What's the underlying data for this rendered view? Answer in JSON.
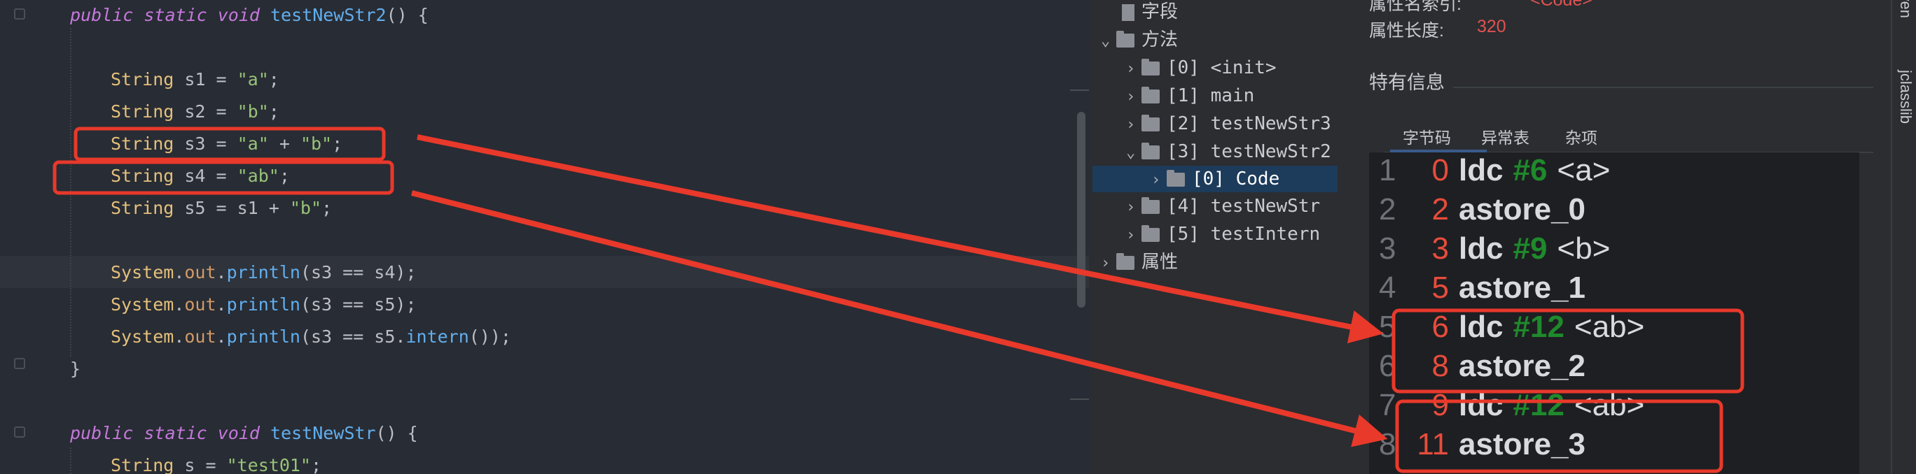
{
  "editor": {
    "lines": [
      {
        "parts": [
          [
            "kw",
            "public static void "
          ],
          [
            "fn",
            "testNewStr2"
          ],
          [
            "pl",
            "() {"
          ]
        ]
      },
      {
        "parts": []
      },
      {
        "parts": [
          [
            "ty",
            "String "
          ],
          [
            "pl",
            "s1 = "
          ],
          [
            "st",
            "\"a\""
          ],
          [
            "pl",
            ";"
          ]
        ]
      },
      {
        "parts": [
          [
            "ty",
            "String "
          ],
          [
            "pl",
            "s2 = "
          ],
          [
            "st",
            "\"b\""
          ],
          [
            "pl",
            ";"
          ]
        ]
      },
      {
        "parts": [
          [
            "ty",
            "String "
          ],
          [
            "pl",
            "s3 = "
          ],
          [
            "st",
            "\"a\""
          ],
          [
            "pl",
            " + "
          ],
          [
            "st",
            "\"b\""
          ],
          [
            "pl",
            ";"
          ]
        ]
      },
      {
        "parts": [
          [
            "ty",
            "String "
          ],
          [
            "pl",
            "s4 = "
          ],
          [
            "st",
            "\"ab\""
          ],
          [
            "pl",
            ";"
          ]
        ]
      },
      {
        "parts": [
          [
            "ty",
            "String "
          ],
          [
            "pl",
            "s5 = s1 + "
          ],
          [
            "st",
            "\"b\""
          ],
          [
            "pl",
            ";"
          ]
        ]
      },
      {
        "parts": []
      },
      {
        "parts": [
          [
            "ty",
            "System"
          ],
          [
            "pl",
            "."
          ],
          [
            "fd",
            "out"
          ],
          [
            "pl",
            "."
          ],
          [
            "fn",
            "println"
          ],
          [
            "pl",
            "(s3 == s4);"
          ]
        ]
      },
      {
        "parts": [
          [
            "ty",
            "System"
          ],
          [
            "pl",
            "."
          ],
          [
            "fd",
            "out"
          ],
          [
            "pl",
            "."
          ],
          [
            "fn",
            "println"
          ],
          [
            "pl",
            "(s3 == s5);"
          ]
        ]
      },
      {
        "parts": [
          [
            "ty",
            "System"
          ],
          [
            "pl",
            "."
          ],
          [
            "fd",
            "out"
          ],
          [
            "pl",
            "."
          ],
          [
            "fn",
            "println"
          ],
          [
            "pl",
            "(s3 == s5."
          ],
          [
            "fn",
            "intern"
          ],
          [
            "pl",
            "());"
          ]
        ]
      },
      {
        "parts": [
          [
            "pl",
            "}"
          ]
        ]
      },
      {
        "parts": []
      },
      {
        "parts": [
          [
            "kw",
            "public static void "
          ],
          [
            "fn",
            "testNewStr"
          ],
          [
            "pl",
            "() {"
          ]
        ]
      },
      {
        "parts": [
          [
            "ty",
            "String "
          ],
          [
            "pl",
            "s = "
          ],
          [
            "st",
            "\"test01\""
          ],
          [
            "pl",
            ";"
          ]
        ]
      }
    ]
  },
  "tree": {
    "field_label": "字段",
    "methods_label": "方法",
    "methods": [
      "[0] <init>",
      "[1] main",
      "[2] testNewStr3",
      "[3] testNewStr2",
      "[4] testNewStr",
      "[5] testIntern"
    ],
    "code_node": "[0] Code",
    "attributes_label": "属性"
  },
  "info": {
    "attr_name_index_label": "属性名索引:",
    "attr_name_index_value": "<Code>",
    "attr_length_label": "属性长度:",
    "attr_length_value": "320",
    "specific_info_label": "特有信息",
    "tabs": [
      "字节码",
      "异常表",
      "杂项"
    ]
  },
  "bytecode": [
    {
      "line": "1",
      "offset": "0",
      "op": "ldc",
      "ref": "#6",
      "arg": "<a>"
    },
    {
      "line": "2",
      "offset": "2",
      "op": "astore_0",
      "ref": "",
      "arg": ""
    },
    {
      "line": "3",
      "offset": "3",
      "op": "ldc",
      "ref": "#9",
      "arg": "<b>"
    },
    {
      "line": "4",
      "offset": "5",
      "op": "astore_1",
      "ref": "",
      "arg": ""
    },
    {
      "line": "5",
      "offset": "6",
      "op": "ldc",
      "ref": "#12",
      "arg": "<ab>"
    },
    {
      "line": "6",
      "offset": "8",
      "op": "astore_2",
      "ref": "",
      "arg": ""
    },
    {
      "line": "7",
      "offset": "9",
      "op": "ldc",
      "ref": "#12",
      "arg": "<ab>"
    },
    {
      "line": "8",
      "offset": "11",
      "op": "astore_3",
      "ref": "",
      "arg": ""
    }
  ],
  "side_tabs": [
    "Maven",
    "jclasslib"
  ],
  "colors": {
    "annotation": "#e8392b",
    "selection": "#1d3b5a"
  }
}
